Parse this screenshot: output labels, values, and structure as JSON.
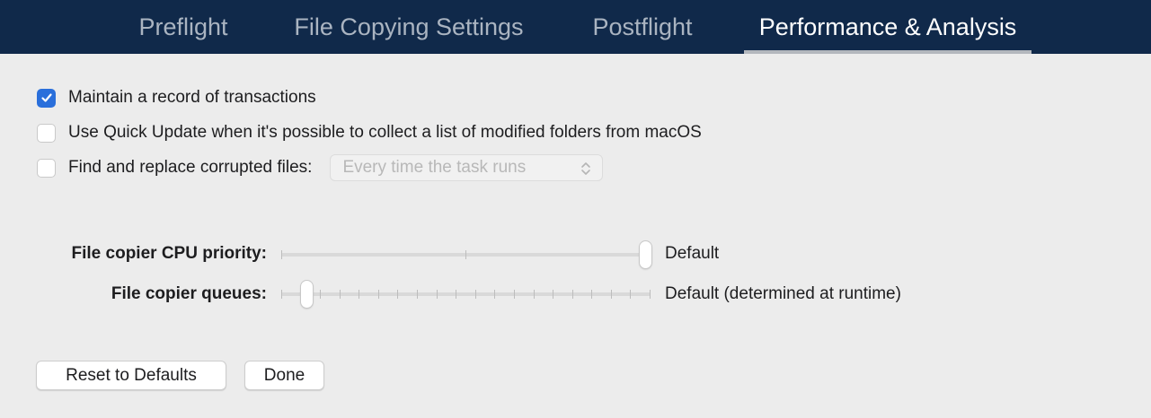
{
  "tabs": {
    "preflight": "Preflight",
    "file_copying": "File Copying Settings",
    "postflight": "Postflight",
    "performance": "Performance & Analysis",
    "active": "Performance & Analysis"
  },
  "options": {
    "maintain_record": {
      "label": "Maintain a record of transactions",
      "checked": true
    },
    "quick_update": {
      "label": "Use Quick Update when it's possible to collect a list of modified folders from macOS",
      "checked": false
    },
    "find_replace": {
      "label": "Find and replace corrupted files:",
      "checked": false,
      "frequency": "Every time the task runs",
      "frequency_enabled": false
    }
  },
  "sliders": {
    "cpu_priority": {
      "label": "File copier CPU priority:",
      "value_text": "Default",
      "position": 1.0
    },
    "queues": {
      "label": "File copier queues:",
      "value_text": "Default (determined at runtime)",
      "position": 0.07
    }
  },
  "buttons": {
    "reset": "Reset to Defaults",
    "done": "Done"
  },
  "colors": {
    "tab_bar": "#10294a",
    "accent": "#2a6fdb",
    "background": "#ececec"
  },
  "icons": {
    "checkmark": "checkmark-icon",
    "popup_arrows": "up-down-chevron-icon"
  }
}
